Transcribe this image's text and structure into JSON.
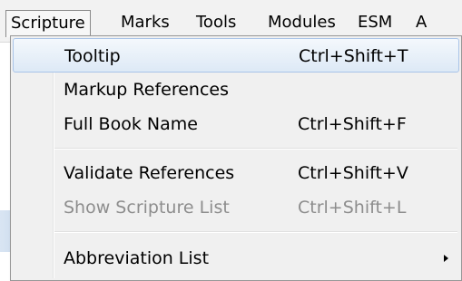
{
  "menubar": {
    "items": [
      {
        "label": "Scripture"
      },
      {
        "label": "Marks"
      },
      {
        "label": "Tools"
      },
      {
        "label": "Modules"
      },
      {
        "label": "ESM"
      },
      {
        "label": "A"
      }
    ]
  },
  "dropdown": {
    "items": [
      {
        "label": "Tooltip",
        "shortcut": "Ctrl+Shift+T"
      },
      {
        "label": "Markup References",
        "shortcut": ""
      },
      {
        "label": "Full Book Name",
        "shortcut": "Ctrl+Shift+F"
      },
      {
        "label": "Validate References",
        "shortcut": "Ctrl+Shift+V"
      },
      {
        "label": "Show Scripture List",
        "shortcut": "Ctrl+Shift+L"
      },
      {
        "label": "Abbreviation List",
        "shortcut": ""
      }
    ]
  }
}
